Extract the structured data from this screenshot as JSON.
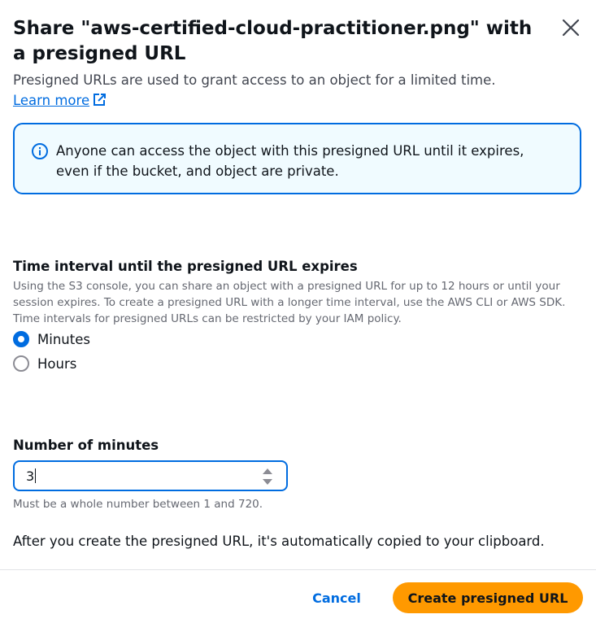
{
  "modal": {
    "title": "Share \"aws-certified-cloud-practitioner.png\" with a presigned URL",
    "description_text": "Presigned URLs are used to grant access to an object for a limited time. ",
    "learn_more_label": "Learn more",
    "info_alert": "Anyone can access the object with this presigned URL until it expires, even if the bucket, and object are private.",
    "time_interval": {
      "label": "Time interval until the presigned URL expires",
      "description": "Using the S3 console, you can share an object with a presigned URL for up to 12 hours or until your session expires. To create a presigned URL with a longer time interval, use the AWS CLI or AWS SDK. Time intervals for presigned URLs can be restricted by your IAM policy.",
      "options": [
        {
          "label": "Minutes",
          "checked": true
        },
        {
          "label": "Hours",
          "checked": false
        }
      ]
    },
    "number_of_minutes": {
      "label": "Number of minutes",
      "value": "3",
      "hint": "Must be a whole number between 1 and 720."
    },
    "clipboard_note": "After you create the presigned URL, it's automatically copied to your clipboard.",
    "buttons": {
      "cancel": "Cancel",
      "create": "Create presigned URL"
    },
    "colors": {
      "primary": "#ff9900",
      "link": "#006ce0",
      "alert_bg": "#f0fbff"
    }
  }
}
